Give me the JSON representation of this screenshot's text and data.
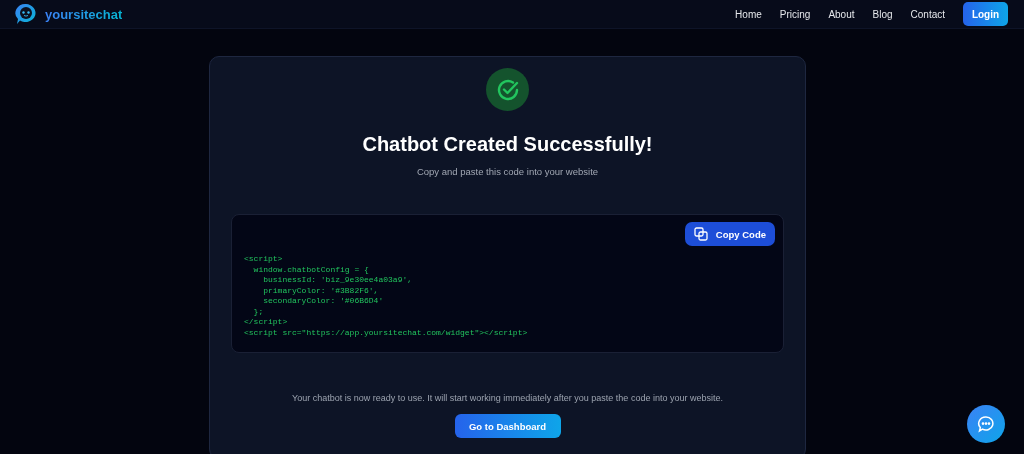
{
  "header": {
    "brand": "yoursitechat",
    "nav": [
      {
        "label": "Home"
      },
      {
        "label": "Pricing"
      },
      {
        "label": "About"
      },
      {
        "label": "Blog"
      },
      {
        "label": "Contact"
      }
    ],
    "login": "Login"
  },
  "card": {
    "title": "Chatbot Created Successfully!",
    "subtitle": "Copy and paste this code into your website",
    "copy_button": "Copy Code",
    "code_lines": [
      "<script>",
      "  window.chatbotConfig = {",
      "    businessId: 'biz_9e30ee4a03a9',",
      "    primaryColor: '#3B82F6',",
      "    secondaryColor: '#06B6D4'",
      "  };",
      "</script>",
      "<script src=\"https://app.yoursitechat.com/widget\"></script>"
    ],
    "note": "Your chatbot is now ready to use. It will start working immediately after you paste the code into your website.",
    "dashboard_button": "Go to Dashboard"
  }
}
